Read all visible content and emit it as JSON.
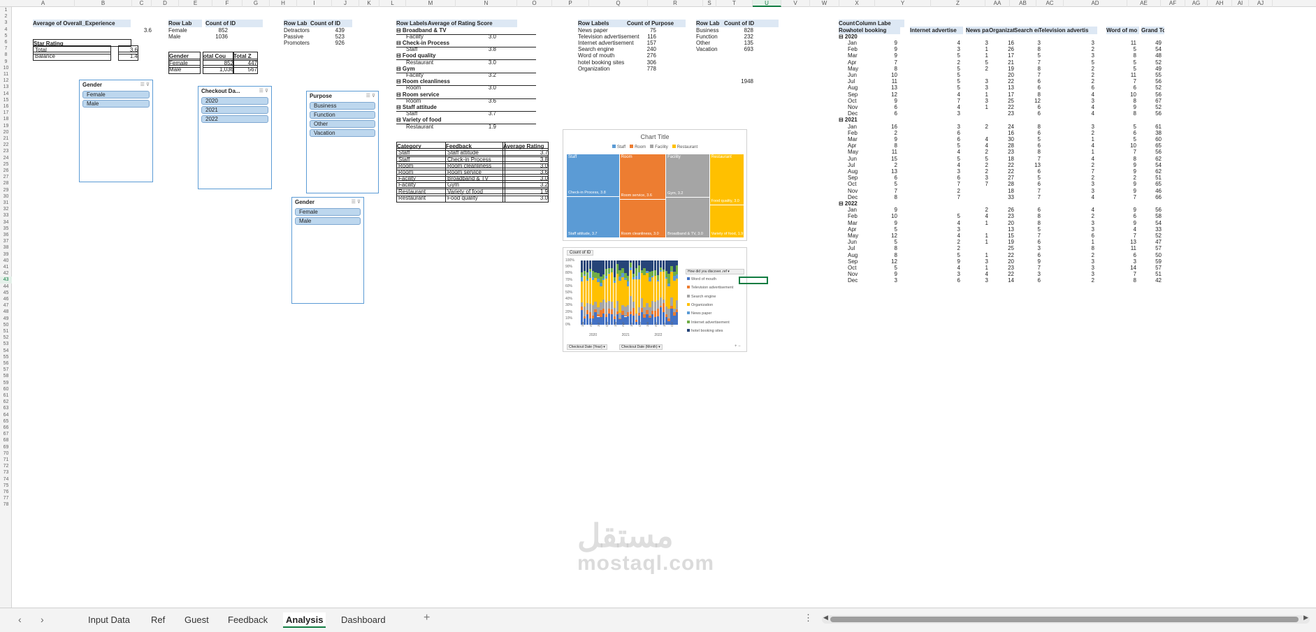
{
  "columns": [
    {
      "l": "A",
      "w": 90
    },
    {
      "l": "B",
      "w": 82
    },
    {
      "l": "C",
      "w": 28
    },
    {
      "l": "D",
      "w": 39
    },
    {
      "l": "E",
      "w": 48
    },
    {
      "l": "F",
      "w": 43
    },
    {
      "l": "G",
      "w": 39
    },
    {
      "l": "H",
      "w": 39
    },
    {
      "l": "I",
      "w": 50
    },
    {
      "l": "J",
      "w": 39
    },
    {
      "l": "K",
      "w": 29
    },
    {
      "l": "L",
      "w": 38
    },
    {
      "l": "M",
      "w": 71
    },
    {
      "l": "N",
      "w": 88
    },
    {
      "l": "O",
      "w": 50
    },
    {
      "l": "P",
      "w": 53
    },
    {
      "l": "Q",
      "w": 84
    },
    {
      "l": "R",
      "w": 79
    },
    {
      "l": "S",
      "w": 19
    },
    {
      "l": "T",
      "w": 52
    },
    {
      "l": "U",
      "w": 41
    },
    {
      "l": "V",
      "w": 41
    },
    {
      "l": "W",
      "w": 42
    },
    {
      "l": "X",
      "w": 51
    },
    {
      "l": "Y",
      "w": 80
    },
    {
      "l": "Z",
      "w": 78
    },
    {
      "l": "AA",
      "w": 35
    },
    {
      "l": "AB",
      "w": 38
    },
    {
      "l": "AC",
      "w": 39
    },
    {
      "l": "AD",
      "w": 91
    },
    {
      "l": "AE",
      "w": 48
    },
    {
      "l": "AF",
      "w": 35
    },
    {
      "l": "AG",
      "w": 32
    },
    {
      "l": "AH",
      "w": 35
    },
    {
      "l": "AI",
      "w": 24
    },
    {
      "l": "AJ",
      "w": 34
    }
  ],
  "selected_column": "U",
  "rows": [
    "1",
    "2",
    "3",
    "4",
    "5",
    "6",
    "7",
    "8",
    "9",
    "10",
    "11",
    "12",
    "13",
    "14",
    "15",
    "16",
    "17",
    "18",
    "19",
    "20",
    "21",
    "22",
    "23",
    "24",
    "25",
    "26",
    "27",
    "28",
    "29",
    "30",
    "31",
    "32",
    "33",
    "34",
    "35",
    "36",
    "37",
    "38",
    "39",
    "40",
    "41",
    "42",
    "43",
    "44",
    "45",
    "46",
    "47",
    "48",
    "49",
    "50",
    "51",
    "52",
    "53",
    "54",
    "55",
    "56",
    "57",
    "58",
    "59",
    "60",
    "61",
    "62",
    "63",
    "64",
    "65",
    "66",
    "67",
    "68",
    "69",
    "70",
    "71",
    "72",
    "73",
    "74",
    "75",
    "76",
    "77",
    "78"
  ],
  "selected_row": "43",
  "overall": {
    "label": "Average of Overall_Experience",
    "value": "3.6"
  },
  "star": {
    "title": "Star Rating",
    "rows": [
      [
        "Total",
        "3.6"
      ],
      [
        "Balance",
        "1.4"
      ]
    ]
  },
  "gender_pivot": {
    "h1": "Row Lab",
    "h2": "Count of ID",
    "rows": [
      [
        "Female",
        "852"
      ],
      [
        "Male",
        "1036"
      ]
    ]
  },
  "gender_total": {
    "headers": [
      "Gender",
      "otal Cou",
      "Total Z"
    ],
    "rows": [
      [
        "Female",
        "852",
        "447"
      ],
      [
        "Male",
        "1,036",
        "567"
      ]
    ]
  },
  "nps_pivot": {
    "h1": "Row Lab",
    "h2": "Count of ID",
    "rows": [
      [
        "Detractors",
        "439"
      ],
      [
        "Passive",
        "523"
      ],
      [
        "Promoters",
        "926"
      ]
    ]
  },
  "rating_pivot": {
    "h1": "Row Labels",
    "h2": "Average of Rating Score",
    "rows": [
      {
        "t": "g",
        "label": "Broadband & TV"
      },
      {
        "t": "i",
        "label": "Facility",
        "v": "3.0"
      },
      {
        "t": "g",
        "label": "Check-in Process"
      },
      {
        "t": "i",
        "label": "Staff",
        "v": "3.8"
      },
      {
        "t": "g",
        "label": "Food quality"
      },
      {
        "t": "i",
        "label": "Restaurant",
        "v": "3.0"
      },
      {
        "t": "g",
        "label": "Gym"
      },
      {
        "t": "i",
        "label": "Facility",
        "v": "3.2"
      },
      {
        "t": "g",
        "label": "Room cleanliness"
      },
      {
        "t": "i",
        "label": "Room",
        "v": "3.0"
      },
      {
        "t": "g",
        "label": "Room service"
      },
      {
        "t": "i",
        "label": "Room",
        "v": "3.6"
      },
      {
        "t": "g",
        "label": "Staff attitude"
      },
      {
        "t": "i",
        "label": "Staff",
        "v": "3.7"
      },
      {
        "t": "g",
        "label": "Variety of food"
      },
      {
        "t": "i",
        "label": "Restaurant",
        "v": "1.9"
      }
    ]
  },
  "feedback_table": {
    "headers": [
      "Category",
      "Feedback",
      "Average Rating"
    ],
    "rows": [
      [
        "Staff",
        "Staff attitude",
        "3.7"
      ],
      [
        "Staff",
        "Check-in Process",
        "3.8"
      ],
      [
        "Room",
        "Room cleanliness",
        "3.0"
      ],
      [
        "Room",
        "Room service",
        "3.6"
      ],
      [
        "Facility",
        "Broadband & TV",
        "3.0"
      ],
      [
        "Facility",
        "Gym",
        "3.2"
      ],
      [
        "Restaurant",
        "Variety of food",
        "1.9"
      ],
      [
        "Restaurant",
        "Food quality",
        "3.0"
      ]
    ]
  },
  "purpose_source_pivot": {
    "h1": "Row Labels",
    "h2": "Count of Purpose",
    "rows": [
      [
        "News paper",
        "75"
      ],
      [
        "Television advertisement",
        "116"
      ],
      [
        "Internet advertisement",
        "157"
      ],
      [
        "Search engine",
        "240"
      ],
      [
        "Word of mouth",
        "276"
      ],
      [
        "hotel booking sites",
        "306"
      ],
      [
        "Organization",
        "778"
      ]
    ]
  },
  "purpose_pivot": {
    "h1": "Row Lab",
    "h2": "Count of ID",
    "rows": [
      [
        "Business",
        "828"
      ],
      [
        "Function",
        "232"
      ],
      [
        "Other",
        "135"
      ],
      [
        "Vacation",
        "693"
      ]
    ],
    "total": "1948"
  },
  "slicers": {
    "gender1": {
      "title": "Gender",
      "items": [
        "Female",
        "Male"
      ]
    },
    "checkout": {
      "title": "Checkout Da...",
      "items": [
        "2020",
        "2021",
        "2022"
      ]
    },
    "purpose": {
      "title": "Purpose",
      "items": [
        "Business",
        "Function",
        "Other",
        "Vacation"
      ]
    },
    "gender2": {
      "title": "Gender",
      "items": [
        "Female",
        "Male"
      ]
    }
  },
  "treemap_chart": {
    "chart_data": {
      "type": "treemap",
      "title": "Chart Title",
      "legend": [
        "Staff",
        "Room",
        "Facility",
        "Restaurant"
      ],
      "colors": [
        "#5b9bd5",
        "#ed7d31",
        "#a5a5a5",
        "#ffc000"
      ],
      "groups": [
        {
          "name": "Staff",
          "items": [
            {
              "label": "Check-in Process, 3.8",
              "value": 3.8
            },
            {
              "label": "Staff attitude, 3.7",
              "value": 3.7
            }
          ]
        },
        {
          "name": "Room",
          "items": [
            {
              "label": "Room service, 3.6",
              "value": 3.6
            },
            {
              "label": "Room cleanliness, 3.0",
              "value": 3.0
            }
          ]
        },
        {
          "name": "Facility",
          "items": [
            {
              "label": "Gym, 3.2",
              "value": 3.2
            },
            {
              "label": "Broadband & TV, 3.0",
              "value": 3.0
            }
          ]
        },
        {
          "name": "Restaurant",
          "items": [
            {
              "label": "Food quality, 3.0",
              "value": 3.0
            },
            {
              "label": "Variety of food, 1.9",
              "value": 1.9
            }
          ]
        }
      ]
    }
  },
  "stack_chart": {
    "button": "Count of ID",
    "filter": "How did you discover..ref",
    "legend": [
      "Word of mouth",
      "Television advertisement",
      "Search engine",
      "Organization",
      "News paper",
      "Internet advertisement",
      "hotel booking sites"
    ],
    "colors": [
      "#4472c4",
      "#ed7d31",
      "#a5a5a5",
      "#ffc000",
      "#5b9bd5",
      "#70ad47",
      "#264478"
    ],
    "yticks": [
      "100%",
      "90%",
      "80%",
      "70%",
      "60%",
      "50%",
      "40%",
      "30%",
      "20%",
      "10%",
      "0%"
    ],
    "xmonths": [
      "Jan",
      "Apr",
      "Jul",
      "Oct",
      "Jan",
      "Apr",
      "Jul",
      "Oct",
      "Jan",
      "Apr",
      "Jul",
      "Oct"
    ],
    "xyears": [
      "2020",
      "2021",
      "2022"
    ],
    "btn_year": "Checkout Date (Year)",
    "btn_month": "Checkout Date (Month)"
  },
  "cross": {
    "h_count": "Count of II",
    "h_col": "Column Labe",
    "h_row": "Row Lab",
    "headers": [
      "hotel booking",
      "Internet advertise",
      "News pap",
      "Organizat",
      "Search eng",
      "Television advertis",
      "Word of mo",
      "Grand Total"
    ],
    "years": [
      {
        "y": "2020",
        "rows": [
          [
            "Jan",
            "9",
            "4",
            "3",
            "16",
            "3",
            "3",
            "11",
            "49"
          ],
          [
            "Feb",
            "9",
            "3",
            "1",
            "26",
            "8",
            "2",
            "5",
            "54"
          ],
          [
            "Mar",
            "9",
            "5",
            "1",
            "17",
            "5",
            "3",
            "8",
            "48"
          ],
          [
            "Apr",
            "7",
            "2",
            "5",
            "21",
            "7",
            "5",
            "5",
            "52"
          ],
          [
            "May",
            "8",
            "5",
            "2",
            "19",
            "8",
            "2",
            "5",
            "49"
          ],
          [
            "Jun",
            "10",
            "5",
            "",
            "20",
            "7",
            "2",
            "11",
            "55"
          ],
          [
            "Jul",
            "11",
            "5",
            "3",
            "22",
            "6",
            "2",
            "7",
            "56"
          ],
          [
            "Aug",
            "13",
            "5",
            "3",
            "13",
            "6",
            "6",
            "6",
            "52"
          ],
          [
            "Sep",
            "12",
            "4",
            "1",
            "17",
            "8",
            "4",
            "10",
            "56"
          ],
          [
            "Oct",
            "9",
            "7",
            "3",
            "25",
            "12",
            "3",
            "8",
            "67"
          ],
          [
            "Nov",
            "6",
            "4",
            "1",
            "22",
            "6",
            "4",
            "9",
            "52"
          ],
          [
            "Dec",
            "6",
            "3",
            "",
            "23",
            "6",
            "4",
            "8",
            "56"
          ]
        ]
      },
      {
        "y": "2021",
        "rows": [
          [
            "Jan",
            "16",
            "3",
            "2",
            "24",
            "8",
            "3",
            "5",
            "61"
          ],
          [
            "Feb",
            "2",
            "6",
            "",
            "16",
            "6",
            "2",
            "6",
            "38"
          ],
          [
            "Mar",
            "9",
            "6",
            "4",
            "30",
            "5",
            "1",
            "5",
            "60"
          ],
          [
            "Apr",
            "8",
            "5",
            "4",
            "28",
            "6",
            "4",
            "10",
            "65"
          ],
          [
            "May",
            "11",
            "4",
            "2",
            "23",
            "8",
            "1",
            "7",
            "56"
          ],
          [
            "Jun",
            "15",
            "5",
            "5",
            "18",
            "7",
            "4",
            "8",
            "62"
          ],
          [
            "Jul",
            "2",
            "4",
            "2",
            "22",
            "13",
            "2",
            "9",
            "54"
          ],
          [
            "Aug",
            "13",
            "3",
            "2",
            "22",
            "6",
            "7",
            "9",
            "62"
          ],
          [
            "Sep",
            "6",
            "6",
            "3",
            "27",
            "5",
            "2",
            "2",
            "51"
          ],
          [
            "Oct",
            "5",
            "7",
            "7",
            "28",
            "6",
            "3",
            "9",
            "65"
          ],
          [
            "Nov",
            "7",
            "2",
            "",
            "18",
            "7",
            "3",
            "9",
            "46"
          ],
          [
            "Dec",
            "8",
            "7",
            "",
            "33",
            "7",
            "4",
            "7",
            "66"
          ]
        ]
      },
      {
        "y": "2022",
        "rows": [
          [
            "Jan",
            "9",
            "",
            "2",
            "26",
            "6",
            "4",
            "9",
            "56"
          ],
          [
            "Feb",
            "10",
            "5",
            "4",
            "23",
            "8",
            "2",
            "6",
            "58"
          ],
          [
            "Mar",
            "9",
            "4",
            "1",
            "20",
            "8",
            "3",
            "9",
            "54"
          ],
          [
            "Apr",
            "5",
            "3",
            "",
            "13",
            "5",
            "3",
            "4",
            "33"
          ],
          [
            "May",
            "12",
            "4",
            "1",
            "15",
            "7",
            "6",
            "7",
            "52"
          ],
          [
            "Jun",
            "5",
            "2",
            "1",
            "19",
            "6",
            "1",
            "13",
            "47"
          ],
          [
            "Jul",
            "8",
            "2",
            "",
            "25",
            "3",
            "8",
            "11",
            "57"
          ],
          [
            "Aug",
            "8",
            "5",
            "1",
            "22",
            "6",
            "2",
            "6",
            "50"
          ],
          [
            "Sep",
            "12",
            "9",
            "3",
            "20",
            "9",
            "3",
            "3",
            "59"
          ],
          [
            "Oct",
            "5",
            "4",
            "1",
            "23",
            "7",
            "3",
            "14",
            "57"
          ],
          [
            "Nov",
            "9",
            "3",
            "4",
            "22",
            "3",
            "3",
            "7",
            "51"
          ],
          [
            "Dec",
            "3",
            "6",
            "3",
            "14",
            "6",
            "2",
            "8",
            "42"
          ]
        ]
      }
    ]
  },
  "tabs": [
    "Input Data",
    "Ref",
    "Guest",
    "Feedback",
    "Analysis",
    "Dashboard"
  ],
  "active_tab": "Analysis",
  "tab_add_label": "+",
  "more_label": "⋮",
  "watermark": {
    "domain": "mostaql.com",
    "logo": "مستقل"
  }
}
